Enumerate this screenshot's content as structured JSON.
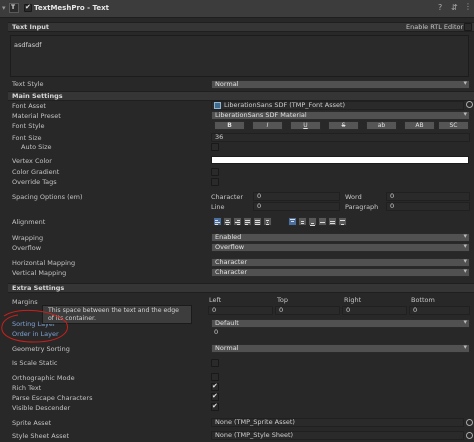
{
  "header": {
    "title": "TextMeshPro - Text",
    "enabled": true
  },
  "text_input": {
    "section_label": "Text Input",
    "rtl_label": "Enable RTL Editor",
    "value": "asdfasdf",
    "text_style_label": "Text Style",
    "text_style_value": "Normal"
  },
  "main_settings": {
    "section_label": "Main Settings",
    "font_asset_label": "Font Asset",
    "font_asset_value": "LiberationSans SDF (TMP_Font Asset)",
    "material_preset_label": "Material Preset",
    "material_preset_value": "LiberationSans SDF Material",
    "font_style_label": "Font Style",
    "font_style_buttons": [
      "B",
      "I",
      "U",
      "S",
      "ab",
      "AB",
      "SC"
    ],
    "font_size_label": "Font Size",
    "font_size_value": "36",
    "auto_size_label": "Auto Size",
    "vertex_color_label": "Vertex Color",
    "vertex_color": "#ffffff",
    "color_gradient_label": "Color Gradient",
    "override_tags_label": "Override Tags",
    "spacing_label": "Spacing Options (em)",
    "spacing": {
      "character_label": "Character",
      "character_value": "0",
      "word_label": "Word",
      "word_value": "0",
      "line_label": "Line",
      "line_value": "0",
      "paragraph_label": "Paragraph",
      "paragraph_value": "0"
    },
    "alignment_label": "Alignment",
    "wrapping_label": "Wrapping",
    "wrapping_value": "Enabled",
    "overflow_label": "Overflow",
    "overflow_value": "Overflow",
    "hmapping_label": "Horizontal Mapping",
    "hmapping_value": "Character",
    "vmapping_label": "Vertical Mapping",
    "vmapping_value": "Character"
  },
  "extra_settings": {
    "section_label": "Extra Settings",
    "margins_label": "Margins",
    "margin_cols": {
      "left": "Left",
      "top": "Top",
      "right": "Right",
      "bottom": "Bottom"
    },
    "margin_values": {
      "left": "0",
      "top": "0",
      "right": "0",
      "bottom": "0"
    },
    "tooltip": "This space between the text and the edge of its container.",
    "sorting_layer_label": "Sorting Layer",
    "sorting_layer_value": "Default",
    "order_in_layer_label": "Order in Layer",
    "order_in_layer_value": "0",
    "geometry_sorting_label": "Geometry Sorting",
    "geometry_sorting_value": "Normal",
    "is_scale_static_label": "Is Scale Static",
    "orthographic_label": "Orthographic Mode",
    "rich_text_label": "Rich Text",
    "parse_escape_label": "Parse Escape Characters",
    "visible_descender_label": "Visible Descender",
    "sprite_asset_label": "Sprite Asset",
    "sprite_asset_value": "None (TMP_Sprite Asset)",
    "style_sheet_label": "Style Sheet Asset",
    "style_sheet_value": "None (TMP_Style Sheet)"
  },
  "colors": {
    "annotation": "#c8201a",
    "accent": "#4a6f9e",
    "label_link": "#7fa3d6"
  }
}
